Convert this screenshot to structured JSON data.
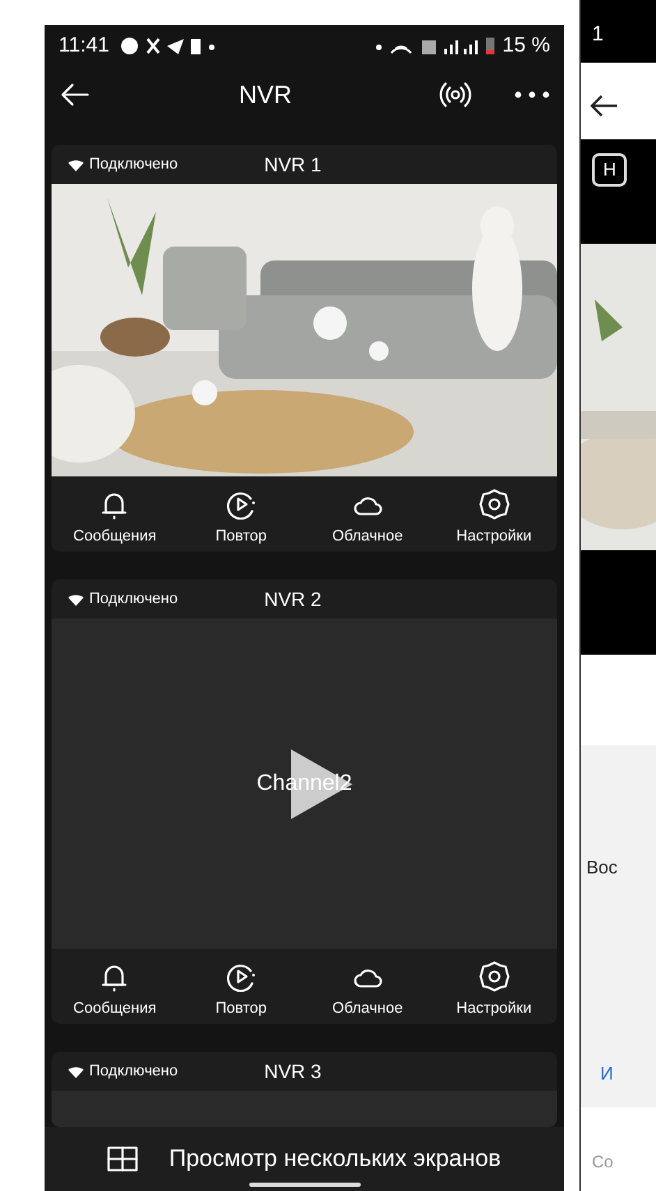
{
  "status_bar": {
    "time": "11:41",
    "battery": "15 %"
  },
  "header": {
    "title": "NVR"
  },
  "devices": [
    {
      "status": "Подключено",
      "name": "NVR 1",
      "actions": [
        {
          "kind": "bell",
          "label": "Сообщения"
        },
        {
          "kind": "replay",
          "label": "Повтор"
        },
        {
          "kind": "cloud",
          "label": "Облачное"
        },
        {
          "kind": "settings",
          "label": "Настройки"
        }
      ]
    },
    {
      "status": "Подключено",
      "name": "NVR 2",
      "view": {
        "kind": "channel",
        "label": "Channel2"
      },
      "actions": [
        {
          "kind": "bell",
          "label": "Сообщения"
        },
        {
          "kind": "replay",
          "label": "Повтор"
        },
        {
          "kind": "cloud",
          "label": "Облачное"
        },
        {
          "kind": "settings",
          "label": "Настройки"
        }
      ]
    },
    {
      "status": "Подключено",
      "name": "NVR 3",
      "view": {
        "kind": "empty"
      }
    }
  ],
  "bottom_bar": {
    "label": "Просмотр нескольких экранов"
  },
  "second_screen": {
    "time": "1",
    "tag": "Н",
    "text": "Вос",
    "link": "И",
    "footer": "Со"
  }
}
